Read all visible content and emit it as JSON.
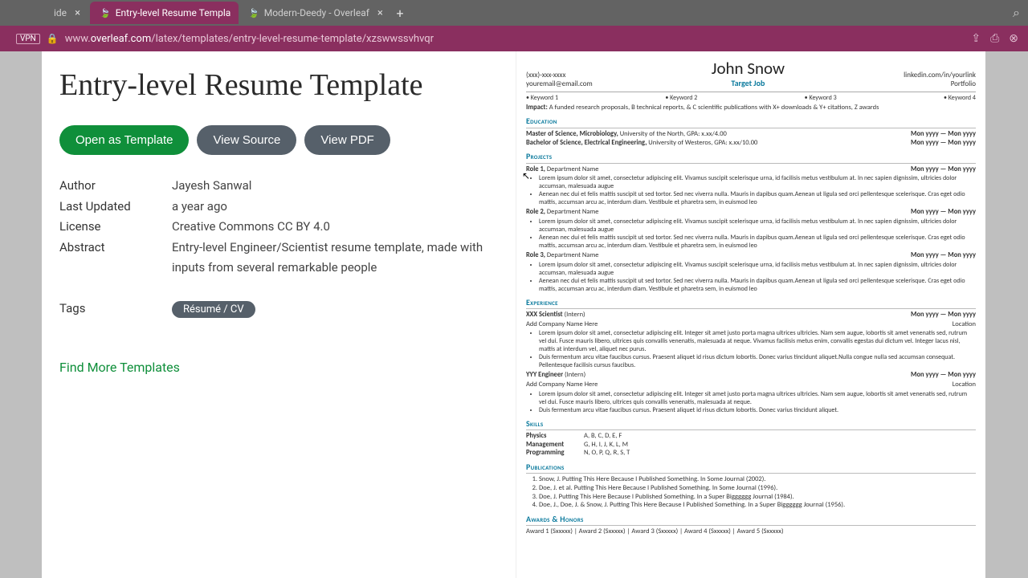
{
  "browser": {
    "tabs": [
      {
        "title": "ide",
        "active": false
      },
      {
        "title": "Entry-level Resume Templa",
        "active": true
      },
      {
        "title": "Modern-Deedy - Overleaf",
        "active": false
      }
    ],
    "url_prefix": "www.",
    "url_domain": "overleaf.com",
    "url_path": "/latex/templates/entry-level-resume-template/xzswwssvhvqr",
    "vpn": "VPN"
  },
  "page": {
    "title": "Entry-level Resume Template",
    "buttons": {
      "open": "Open as Template",
      "source": "View Source",
      "pdf": "View PDF"
    },
    "meta": {
      "author_label": "Author",
      "author": "Jayesh Sanwal",
      "updated_label": "Last Updated",
      "updated": "a year ago",
      "license_label": "License",
      "license": "Creative Commons CC BY 4.0",
      "abstract_label": "Abstract",
      "abstract": "Entry-level Engineer/Scientist resume template, made with inputs from several remarkable people",
      "tags_label": "Tags",
      "tag1": "Résumé / CV"
    },
    "more": "Find More Templates"
  },
  "resume": {
    "contact_left_1": "(xxx)-xxx-xxxx",
    "contact_left_2": "youremail@email.com",
    "name": "John Snow",
    "target": "Target Job",
    "contact_right_1": "linkedin.com/in/yourlink",
    "contact_right_2": "Portfolio",
    "keywords": [
      "Keyword 1",
      "Keyword 2",
      "Keyword 3",
      "Keyword 4"
    ],
    "impact_label": "Impact:",
    "impact": "A funded research proposals, B technical reports, & C scientific publications with X+ downloads & Y+ citations, Z awards",
    "sections": {
      "education": "Education",
      "projects": "Projects",
      "experience": "Experience",
      "skills": "Skills",
      "publications": "Publications",
      "awards": "Awards & Honors"
    },
    "edu1": "Master of Science, Microbiology, University of the North, GPA: x.xx/4.00",
    "edu1_bold": "Master of Science, Microbiology,",
    "edu1_rest": " University of the North, GPA: x.xx/4.00",
    "edu2_bold": "Bachelor of Science, Electrical Engineering,",
    "edu2_rest": " University of Westeros, GPA: x.xx/10.00",
    "daterange": "Mon yyyy — Mon yyyy",
    "role1": "Role 1,",
    "role2": "Role 2,",
    "role3": "Role 3,",
    "dept": " Department Name",
    "bullet_long": "Lorem ipsum dolor sit amet, consectetur adipiscing elit. Vivamus suscipit scelerisque urna, id facilisis metus vestibulum at. In nec sapien dignissim, ultricies dolor accumsan, malesuada augue",
    "bullet_med": "Aenean nec dui et felis mattis suscipit ut sed tortor. Sed nec viverra nulla. Mauris in dapibus quam.Aenean ut ligula sed orci pellentesque scelerisque. Cras eget odio mattis, accumsan arcu ac, interdum diam. Vestibule et pharetra sem, in euismod leo",
    "exp1_title": "XXX Scientist",
    "exp2_title": "YYY Engineer",
    "intern": " (Intern)",
    "company": "Add Company Name Here",
    "location": "Location",
    "exp_b1": "Lorem ipsum dolor sit amet, consectetur adipiscing elit. Integer sit amet justo porta magna ultrices ultricies. Nam sem augue, lobortis sit amet venenatis sed, rutrum vel dui. Fusce mauris libero, ultrices quis convallis venenatis, malesuada at neque. Vivamus facilisis metus enim, convallis egestas dui dictum vel. Integer lacus nisl, mattis at interdum vel, aliquet nec purus.",
    "exp_b2": "Duis fermentum arcu vitae faucibus cursus. Praesent aliquet id risus dictum lobortis. Donec varius tincidunt aliquet.Nulla congue nulla sed accumsan consequat. Pellentesque facilisis cursus faucibus.",
    "exp2_b1": "Lorem ipsum dolor sit amet, consectetur adipiscing elit. Integer sit amet justo porta magna ultrices ultricies. Nam sem augue, lobortis sit amet venenatis sed, rutrum vel dui. Fusce mauris libero, ultrices quis convallis venenatis, malesuada at neque.",
    "exp2_b2": "Duis fermentum arcu vitae faucibus cursus. Praesent aliquet id risus dictum lobortis. Donec varius tincidunt aliquet.",
    "skills": [
      [
        "Physics",
        "A, B, C, D, E, F"
      ],
      [
        "Management",
        "G, H, I, J, K, L, M"
      ],
      [
        "Programming",
        "N, O, P, Q, R, S, T"
      ]
    ],
    "pubs": [
      "Snow, J. Putting This Here Because I Published Something. In Some Journal (2002).",
      "Doe, J. et al. Putting This Here Because I Published Something. In Some Journal (1996).",
      "Doe, J. Putting This Here Because I Published Something. In a Super Bigggggg Journal (1984).",
      "Doe, J., Doe, J. & Snow, J. Putting This Here Because I Published Something. In a Super Bigggggg Journal (1956)."
    ],
    "awards_line": "Award 1 (Sxxxxx) | Award 2 (Sxxxxx) | Award 3 (Sxxxxx) | Award 4 (Sxxxxx) | Award 5 (Sxxxxx)"
  }
}
